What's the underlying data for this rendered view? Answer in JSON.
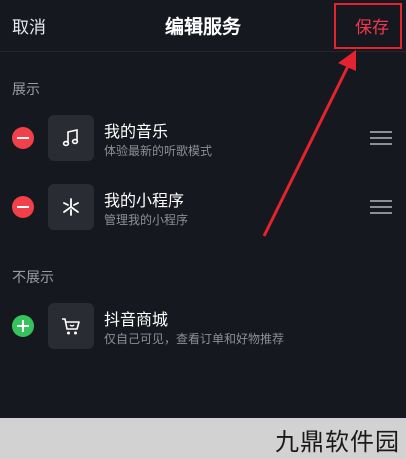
{
  "header": {
    "cancel_label": "取消",
    "title": "编辑服务",
    "save_label": "保存"
  },
  "sections": {
    "shown": {
      "label": "展示",
      "items": [
        {
          "title": "我的音乐",
          "subtitle": "体验最新的听歌模式",
          "icon": "music-note-icon",
          "action": "remove"
        },
        {
          "title": "我的小程序",
          "subtitle": "管理我的小程序",
          "icon": "mini-program-icon",
          "action": "remove"
        }
      ]
    },
    "hidden": {
      "label": "不展示",
      "items": [
        {
          "title": "抖音商城",
          "subtitle": "仅自己可见，查看订单和好物推荐",
          "icon": "shopping-cart-icon",
          "action": "add"
        }
      ]
    }
  },
  "annotation": {
    "highlight_color": "#e3232f"
  },
  "watermark": {
    "text": "九鼎软件园"
  }
}
